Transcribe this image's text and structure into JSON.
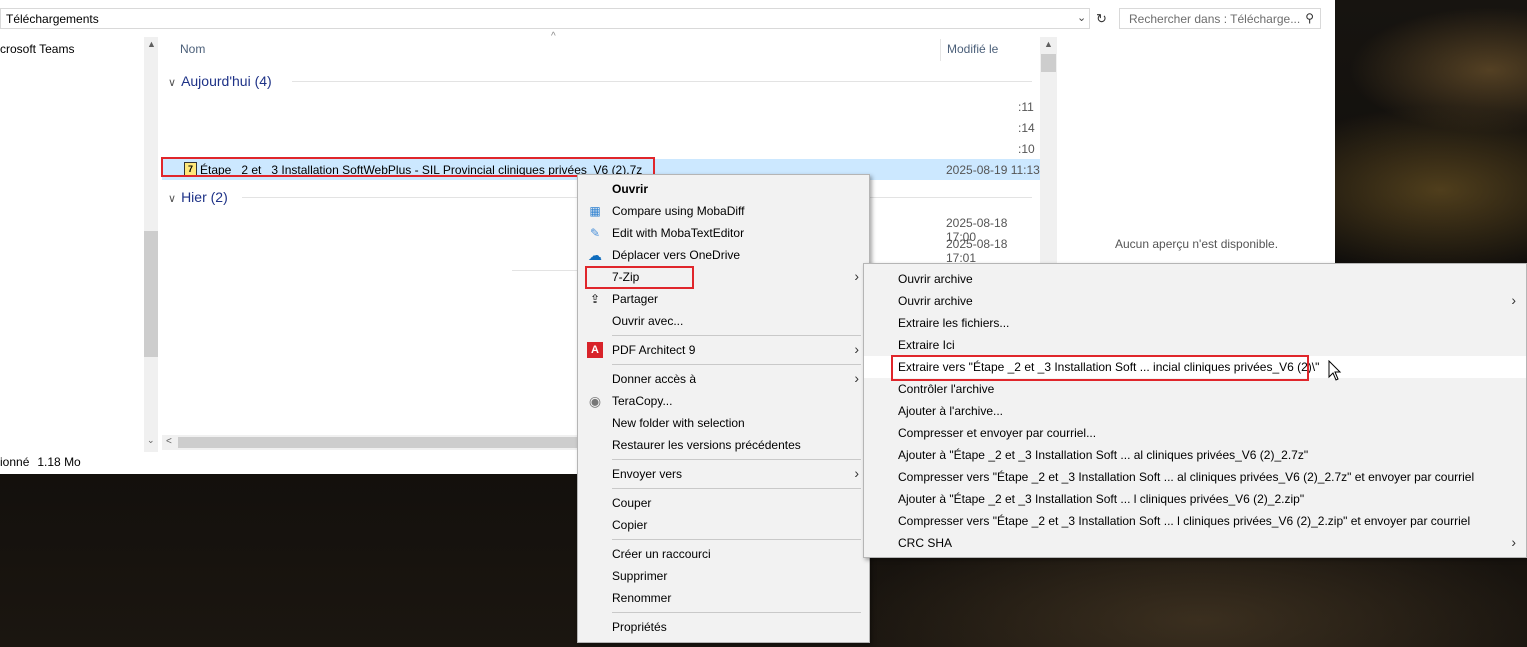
{
  "explorer": {
    "address_path": "Téléchargements",
    "search_placeholder": "Rechercher dans : Télécharge...",
    "nav": {
      "item": "crosoft Teams"
    },
    "columns": {
      "name": "Nom",
      "date_modified": "Modifié le"
    },
    "groups": [
      {
        "label": "Aujourd'hui (4)"
      },
      {
        "label": "Hier (2)"
      }
    ],
    "time_fragments": [
      ":11",
      ":14",
      ":10"
    ],
    "selected_file": {
      "name": "Étape _2 et _3 Installation SoftWebPlus - SIL Provincial cliniques privées_V6 (2).7z",
      "date": "2025-08-19 11:13"
    },
    "yesterday_dates": [
      "2025-08-18 17:00",
      "2025-08-18 17:01"
    ],
    "preview_message": "Aucun aperçu n'est disponible.",
    "status": {
      "selection": "ionné",
      "size": "1.18 Mo"
    }
  },
  "context_menu": {
    "items": [
      {
        "label": "Ouvrir",
        "bold": true,
        "icon": ""
      },
      {
        "label": "Compare using MobaDiff",
        "icon": "mobadiff-icon"
      },
      {
        "label": "Edit with MobaTextEditor",
        "icon": "mobatexteditor-icon"
      },
      {
        "label": "Déplacer vers OneDrive",
        "icon": "onedrive-icon"
      },
      {
        "label": "7-Zip",
        "submenu": true,
        "highlighted": true
      },
      {
        "label": "Partager",
        "icon": "share-icon"
      },
      {
        "label": "Ouvrir avec..."
      },
      {
        "label": "PDF Architect 9",
        "submenu": true,
        "icon": "pdf-architect-icon"
      },
      {
        "label": "Donner accès à",
        "submenu": true
      },
      {
        "label": "TeraCopy...",
        "icon": "teracopy-icon"
      },
      {
        "label": "New folder with selection"
      },
      {
        "label": "Restaurer les versions précédentes"
      },
      {
        "label": "Envoyer vers",
        "submenu": true
      },
      {
        "label": "Couper"
      },
      {
        "label": "Copier"
      },
      {
        "label": "Créer un raccourci"
      },
      {
        "label": "Supprimer"
      },
      {
        "label": "Renommer"
      },
      {
        "label": "Propriétés"
      }
    ]
  },
  "zip_submenu": {
    "items": [
      {
        "label": "Ouvrir archive"
      },
      {
        "label": "Ouvrir archive",
        "submenu": true
      },
      {
        "label": "Extraire les fichiers..."
      },
      {
        "label": "Extraire Ici"
      },
      {
        "label": "Extraire vers \"Étape _2 et _3 Installation Soft ... incial cliniques privées_V6 (2)\\\"",
        "highlighted": true
      },
      {
        "label": "Contrôler l'archive"
      },
      {
        "label": "Ajouter à l'archive..."
      },
      {
        "label": "Compresser et envoyer par courriel..."
      },
      {
        "label": "Ajouter à \"Étape _2 et _3 Installation Soft ... al cliniques privées_V6 (2)_2.7z\""
      },
      {
        "label": "Compresser vers \"Étape _2 et _3 Installation Soft ... al cliniques privées_V6 (2)_2.7z\" et envoyer par courriel"
      },
      {
        "label": "Ajouter à \"Étape _2 et _3 Installation Soft ... l cliniques privées_V6 (2)_2.zip\""
      },
      {
        "label": "Compresser vers \"Étape _2 et _3 Installation Soft ... l cliniques privées_V6 (2)_2.zip\" et envoyer par courriel"
      },
      {
        "label": "CRC SHA",
        "submenu": true
      }
    ]
  },
  "colors": {
    "highlight_box": "#e0262b",
    "selection": "#cce8ff",
    "group_header": "#1e3287"
  }
}
